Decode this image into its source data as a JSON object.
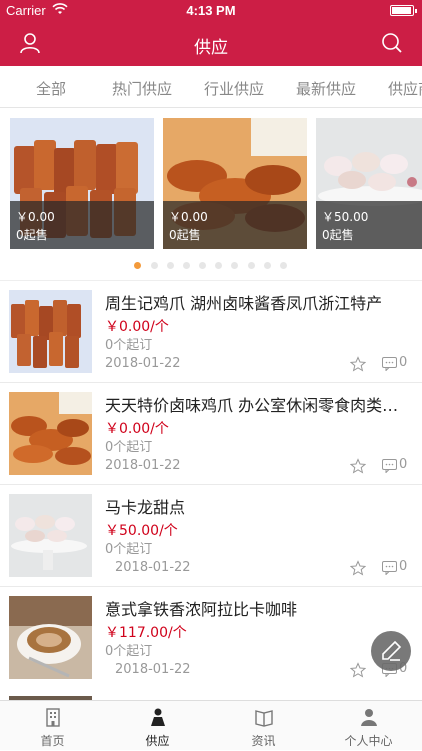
{
  "status": {
    "carrier": "Carrier",
    "time": "4:13 PM"
  },
  "nav": {
    "title": "供应",
    "user_icon": "user-icon",
    "search_icon": "search-icon"
  },
  "tabs": [
    {
      "label": "全部"
    },
    {
      "label": "热门供应"
    },
    {
      "label": "行业供应"
    },
    {
      "label": "最新供应"
    },
    {
      "label": "供应商"
    }
  ],
  "carousel": [
    {
      "price": "￥0.00",
      "min": "0起售"
    },
    {
      "price": "￥0.00",
      "min": "0起售"
    },
    {
      "price": "￥50.00",
      "min": "0起售"
    }
  ],
  "list": [
    {
      "name": "周生记鸡爪 湖州卤味酱香凤爪浙江特产",
      "price": "￥0.00/个",
      "min": "0个起订",
      "date": "2018-01-22",
      "comments": "0"
    },
    {
      "name": "天天特价卤味鸡爪 办公室休闲零食肉类小吃",
      "price": "￥0.00/个",
      "min": "0个起订",
      "date": "2018-01-22",
      "comments": "0"
    },
    {
      "name": "马卡龙甜点",
      "price": "￥50.00/个",
      "min": "0个起订",
      "date": "2018-01-22",
      "comments": "0"
    },
    {
      "name": "意式拿铁香浓阿拉比卡咖啡",
      "price": "￥117.00/个",
      "min": "0个起订",
      "date": "2018-01-22",
      "comments": "0"
    }
  ],
  "tabbar": [
    {
      "label": "首页",
      "icon": "home-building-icon"
    },
    {
      "label": "供应",
      "icon": "supply-person-icon"
    },
    {
      "label": "资讯",
      "icon": "news-book-icon"
    },
    {
      "label": "个人中心",
      "icon": "profile-icon"
    }
  ],
  "colors": {
    "brand": "#cc1e45",
    "price": "#d0021b",
    "active_dot": "#f39a3b"
  }
}
